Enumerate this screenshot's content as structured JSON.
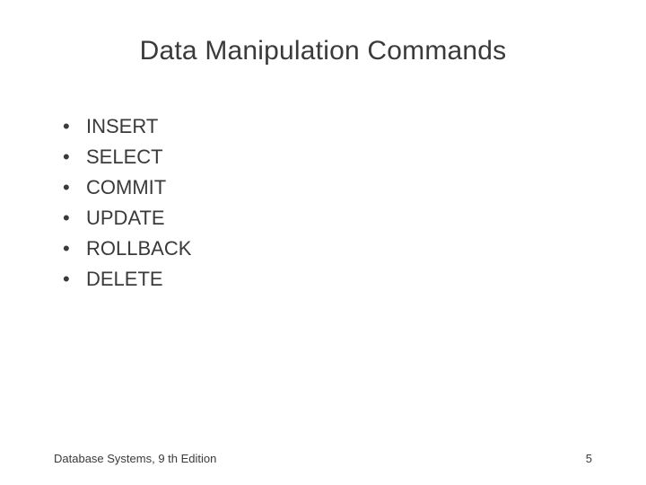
{
  "title": "Data Manipulation Commands",
  "items": [
    "INSERT",
    "SELECT",
    "COMMIT",
    "UPDATE",
    "ROLLBACK",
    "DELETE"
  ],
  "footer": {
    "left": "Database Systems, 9 th Edition",
    "right": "5"
  }
}
